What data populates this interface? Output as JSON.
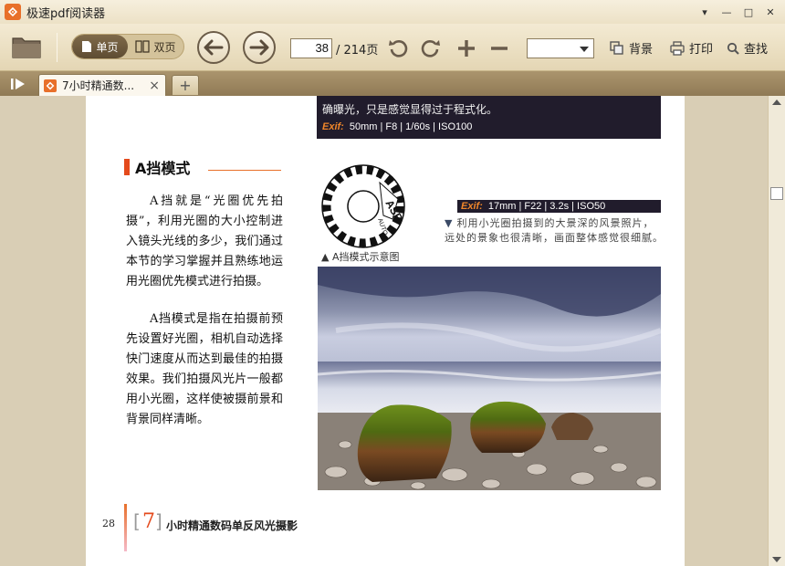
{
  "window": {
    "title": "极速pdf阅读器",
    "controls": [
      "▾",
      "—",
      "□",
      "✕"
    ]
  },
  "toolbar": {
    "view_single": "单页",
    "view_double": "双页",
    "current_page": "38",
    "total_pages": "/ 214页",
    "background_label": "背景",
    "print_label": "打印",
    "find_label": "查找"
  },
  "tabs": {
    "active_label": "7小时精通数...",
    "close": "×",
    "add": "+"
  },
  "document": {
    "top_caption": "确曝光，只是感觉显得过于程式化。",
    "top_exif_tag": "Exif:",
    "top_exif_values": "50mm | F8 | 1/60s | ISO100",
    "section_title": "A挡模式",
    "para1": "A挡就是“光圈优先拍摄”，利用光圈的大小控制进入镜头光线的多少，我们通过本节的学习掌握并且熟练地运用光圈优先模式进行拍摄。",
    "para2": "A挡模式是指在拍摄前预先设置好光圈，相机自动选择快门速度从而达到最佳的拍摄效果。我们拍摄风光片一般都用小光圈，这样使被摄前景和背景同样清晰。",
    "dial_caption": "▲ A挡模式示意图",
    "dial_label": "ASP",
    "dial_auto": "AUTO",
    "photo_exif_tag": "Exif:",
    "photo_exif_values": "17mm | F22 | 3.2s | ISO50",
    "photo_caption_marker": "▼",
    "photo_caption": "利用小光圈拍摄到的大景深的风景照片，远处的景象也很清晰，画面整体感觉很细腻。",
    "page_number": "28",
    "chapter_number": "7",
    "chapter_bracket_open": "[",
    "chapter_bracket_close": "]",
    "chapter_title": "小时精通数码单反风光摄影"
  },
  "colors": {
    "accent": "#e8702a",
    "title_bar": "#e44a1c",
    "toolbar": "#ece1c6",
    "photo_dark": "#211c2c"
  }
}
